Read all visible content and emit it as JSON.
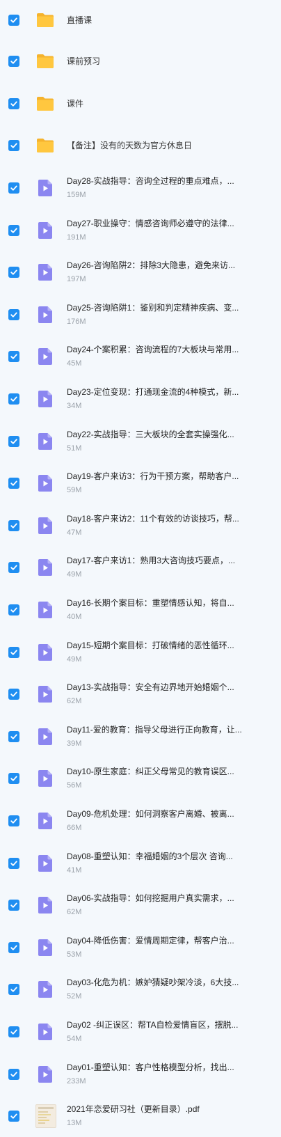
{
  "folders": [
    "直播课",
    "课前预习",
    "课件",
    "【备注】没有的天数为官方休息日"
  ],
  "files": [
    {
      "title": "Day28-实战指导：咨询全过程的重点难点，...",
      "size": "159M"
    },
    {
      "title": "Day27-职业操守：情感咨询师必遵守的法律...",
      "size": "191M"
    },
    {
      "title": "Day26-咨询陷阱2：排除3大隐患，避免来访...",
      "size": "197M"
    },
    {
      "title": "Day25-咨询陷阱1：鉴别和判定精神疾病、变...",
      "size": "176M"
    },
    {
      "title": "Day24-个案积累：咨询流程的7大板块与常用...",
      "size": "45M"
    },
    {
      "title": "Day23-定位变现：打通现金流的4种模式，新...",
      "size": "34M"
    },
    {
      "title": "Day22-实战指导：三大板块的全套实操强化...",
      "size": "51M"
    },
    {
      "title": "Day19-客户来访3：行为干预方案，帮助客户...",
      "size": "59M"
    },
    {
      "title": "Day18-客户来访2：11个有效的访谈技巧，帮...",
      "size": "47M"
    },
    {
      "title": "Day17-客户来访1：熟用3大咨询技巧要点，...",
      "size": "49M"
    },
    {
      "title": "Day16-长期个案目标：重塑情感认知，将自...",
      "size": "40M"
    },
    {
      "title": "Day15-短期个案目标：打破情绪的恶性循环...",
      "size": "49M"
    },
    {
      "title": "Day13-实战指导：安全有边界地开始婚姻个...",
      "size": "62M"
    },
    {
      "title": "Day11-爱的教育：指导父母进行正向教育，让...",
      "size": "39M"
    },
    {
      "title": "Day10-原生家庭：纠正父母常见的教育误区...",
      "size": "56M"
    },
    {
      "title": "Day09-危机处理：如何洞察客户离婚、被离...",
      "size": "66M"
    },
    {
      "title": "Day08-重塑认知：幸福婚姻的3个层次 咨询...",
      "size": "41M"
    },
    {
      "title": "Day06-实战指导：如何挖掘用户真实需求，...",
      "size": "62M"
    },
    {
      "title": "Day04-降低伤害：爱情周期定律，帮客户治...",
      "size": "53M"
    },
    {
      "title": "Day03-化危为机：嫉妒猜疑吵架冷淡，6大技...",
      "size": "52M"
    },
    {
      "title": "Day02 -纠正误区：帮TA自检爱情盲区，摆脱...",
      "size": "54M"
    },
    {
      "title": "Day01-重塑认知：客户性格模型分析，找出...",
      "size": "233M"
    }
  ],
  "pdf": {
    "title": "2021年恋爱研习社（更新目录）.pdf",
    "size": "13M"
  },
  "colors": {
    "background": "#f4f8fc",
    "checkbox": "#1f8ef1",
    "folder": "#ffc53d",
    "video": "#8b86f0",
    "size_text": "#9aa1a9"
  },
  "icons": {
    "checkbox": "check-icon",
    "folder": "folder-icon",
    "video": "video-file-icon",
    "pdf": "pdf-thumbnail-icon"
  }
}
